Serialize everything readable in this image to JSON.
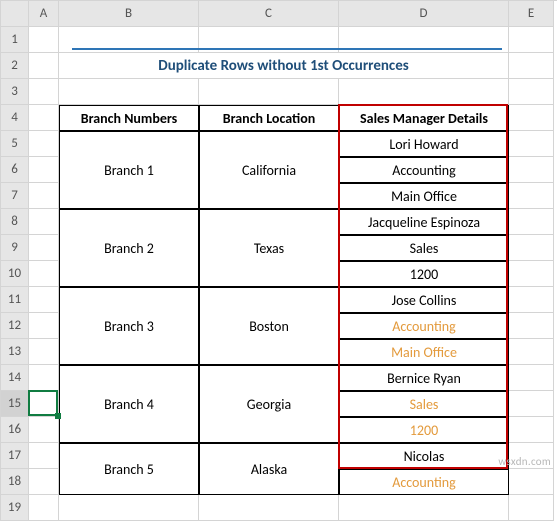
{
  "columns": [
    "",
    "A",
    "B",
    "C",
    "D",
    "E"
  ],
  "row_count": 19,
  "selected_row": 15,
  "title": "Duplicate Rows without 1st Occurrences",
  "headers": {
    "b": "Branch Numbers",
    "c": "Branch Location",
    "d": "Sales Manager Details"
  },
  "rows": [
    {
      "branch": "Branch 1",
      "location": "California",
      "details": [
        "Lori Howard",
        "Accounting",
        "Main Office"
      ],
      "dup": [
        false,
        false,
        false
      ]
    },
    {
      "branch": "Branch 2",
      "location": "Texas",
      "details": [
        "Jacqueline Espinoza",
        "Sales",
        "1200"
      ],
      "dup": [
        false,
        false,
        false
      ]
    },
    {
      "branch": "Branch 3",
      "location": "Boston",
      "details": [
        "Jose Collins",
        "Accounting",
        "Main Office"
      ],
      "dup": [
        false,
        true,
        true
      ]
    },
    {
      "branch": "Branch 4",
      "location": "Georgia",
      "details": [
        "Bernice Ryan",
        "Sales",
        "1200"
      ],
      "dup": [
        false,
        true,
        true
      ]
    },
    {
      "branch": "Branch 5",
      "location": "Alaska",
      "details": [
        "Nicolas",
        "Accounting"
      ],
      "dup": [
        false,
        true
      ]
    }
  ],
  "watermark": "wsxdn.com",
  "colors": {
    "title": "#1f4e79",
    "title_underline": "#2e75b6",
    "duplicate_text": "#e39a3c",
    "highlight_border": "#c00000",
    "selection": "#107c41"
  }
}
